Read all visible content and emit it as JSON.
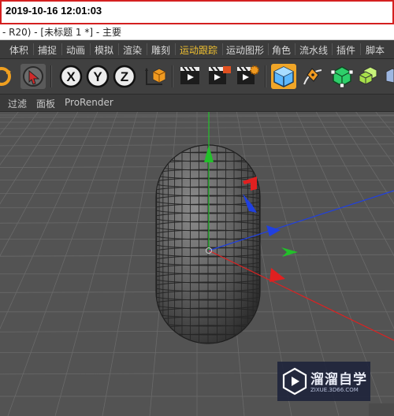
{
  "timestamp": "2019-10-16 12:01:03",
  "window": {
    "title": "- R20) - [未标题 1 *] - 主要"
  },
  "menubar": {
    "items": [
      {
        "label": "体积",
        "highlight": false
      },
      {
        "label": "捕捉",
        "highlight": false
      },
      {
        "label": "动画",
        "highlight": false
      },
      {
        "label": "模拟",
        "highlight": false
      },
      {
        "label": "渲染",
        "highlight": false
      },
      {
        "label": "雕刻",
        "highlight": false
      },
      {
        "label": "运动跟踪",
        "highlight": true
      },
      {
        "label": "运动图形",
        "highlight": false
      },
      {
        "label": "角色",
        "highlight": false
      },
      {
        "label": "流水线",
        "highlight": false
      },
      {
        "label": "插件",
        "highlight": false
      },
      {
        "label": "脚本",
        "highlight": false
      }
    ]
  },
  "toolbar": {
    "buttons": [
      {
        "icon": "rotate-tool-icon"
      },
      {
        "icon": "live-selection-icon"
      },
      {
        "icon": "x-axis-lock-icon",
        "label": "X"
      },
      {
        "icon": "y-axis-lock-icon",
        "label": "Y"
      },
      {
        "icon": "z-axis-lock-icon",
        "label": "Z"
      },
      {
        "icon": "coordinate-system-icon"
      },
      {
        "icon": "render-view-icon"
      },
      {
        "icon": "render-to-picture-viewer-icon"
      },
      {
        "icon": "render-settings-icon"
      },
      {
        "icon": "cube-primitive-icon"
      },
      {
        "icon": "pen-spline-icon"
      },
      {
        "icon": "subdivision-surface-icon"
      },
      {
        "icon": "cloner-icon"
      },
      {
        "icon": "more-icon"
      }
    ]
  },
  "viewport_menu": {
    "items": [
      "过滤",
      "面板",
      "ProRender"
    ]
  },
  "watermark": {
    "text": "溜溜自学",
    "url": "ZIXUE.3D66.COM"
  },
  "colors": {
    "viewport_bg": "#535353",
    "grid": "#6a6a6a",
    "y_axis": "#22c02a",
    "x_axis": "#e02020",
    "z_axis": "#2040e0",
    "menu_highlight": "#f0c030",
    "timestamp_border": "#d42020"
  }
}
